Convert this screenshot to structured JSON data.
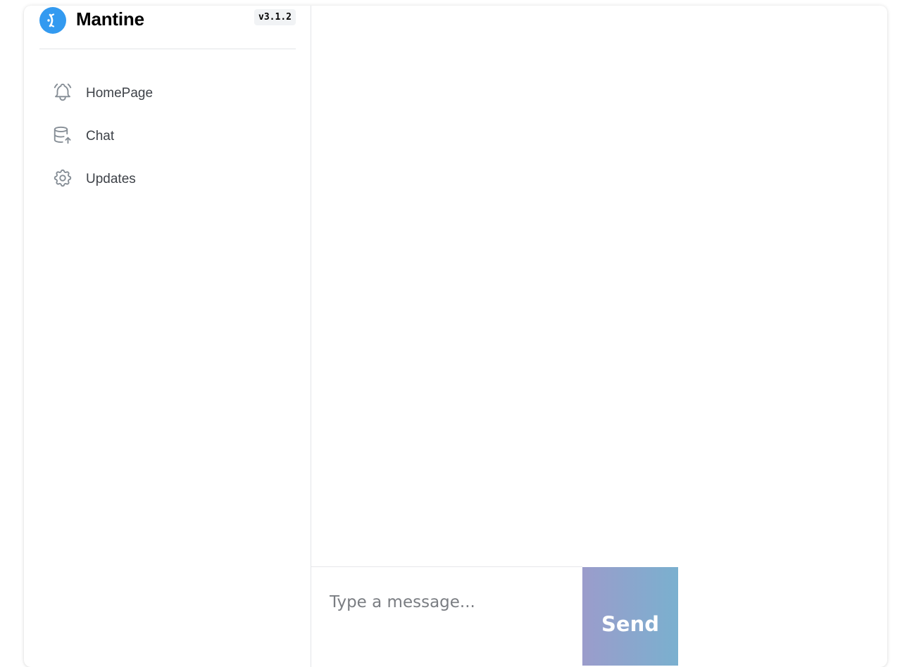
{
  "brand": {
    "name": "Mantine",
    "version": "v3.1.2",
    "logo_icon": "mantine-logo-icon",
    "logo_color": "#339af0"
  },
  "sidebar": {
    "items": [
      {
        "label": "HomePage",
        "icon": "bell-ringing-icon"
      },
      {
        "label": "Chat",
        "icon": "database-import-icon"
      },
      {
        "label": "Updates",
        "icon": "settings-gear-icon"
      }
    ],
    "icon_color": "#868e96"
  },
  "composer": {
    "placeholder": "Type a message...",
    "value": "",
    "send_label": "Send",
    "send_gradient": [
      "#9b9ccb",
      "#7ab0cf"
    ]
  }
}
